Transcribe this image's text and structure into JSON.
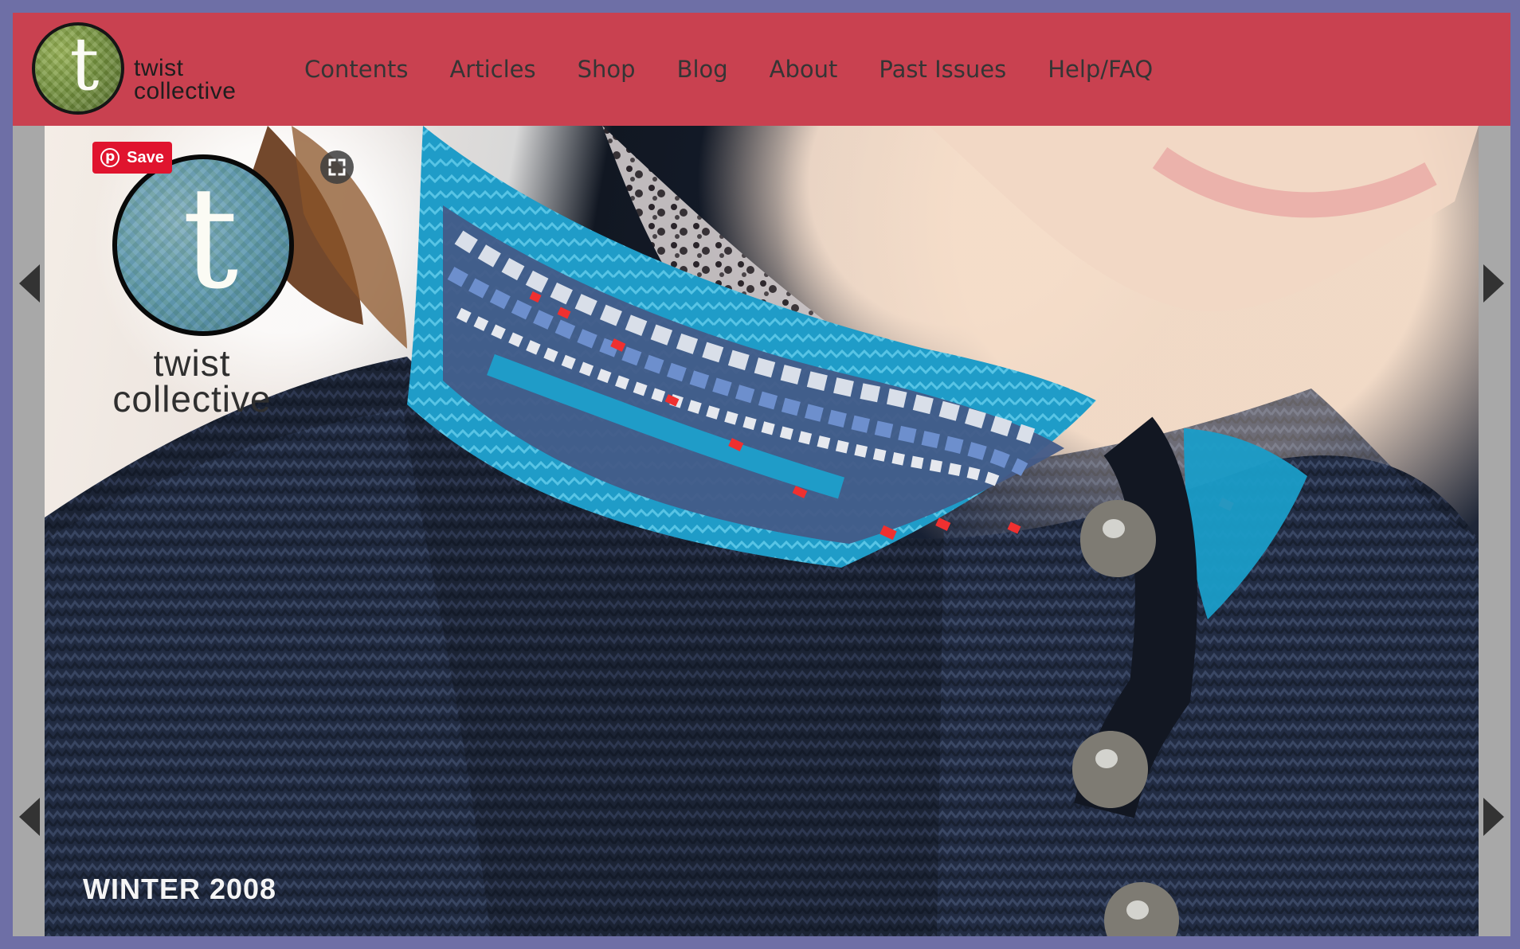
{
  "site": {
    "brand_line_1": "twist",
    "brand_line_2": "collective",
    "logo_letter": "t"
  },
  "nav": {
    "items": [
      "Contents",
      "Articles",
      "Shop",
      "Blog",
      "About",
      "Past Issues",
      "Help/FAQ"
    ]
  },
  "hero": {
    "cover_letter": "t",
    "cover_line_1": "twist",
    "cover_line_2": "collective",
    "issue": "WINTER 2008",
    "save_label": "Save"
  },
  "icons": {
    "logo": "logo-icon",
    "pinterest": "pinterest-icon",
    "expand": "expand-icon",
    "left_arrow": "left-arrow-icon",
    "right_arrow": "right-arrow-icon"
  },
  "colors": {
    "page_background": "#6e6fa6",
    "header": "#c94150",
    "pinterest": "#e0142e",
    "nav_text": "#353535"
  }
}
